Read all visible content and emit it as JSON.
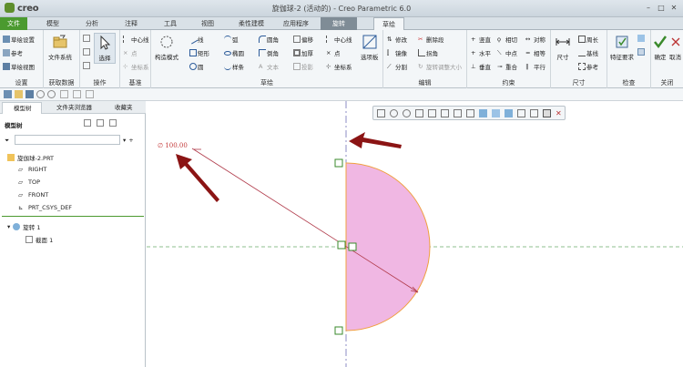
{
  "app": {
    "logo": "creo",
    "window_title": "旋伽球-2 (活动的) - Creo Parametric 6.0"
  },
  "colors": {
    "file_tab": "#4b9a2f",
    "context_tab": "#7f8c96",
    "arrow": "#8b1414",
    "fill": "#f0b7e3",
    "edge": "#f0a040",
    "dim": "#c43a3a"
  },
  "tabs": [
    {
      "label": "文件"
    },
    {
      "label": "模型"
    },
    {
      "label": "分析"
    },
    {
      "label": "注释"
    },
    {
      "label": "工具"
    },
    {
      "label": "视图"
    },
    {
      "label": "柔性建模"
    },
    {
      "label": "应用程序"
    },
    {
      "label": "旋转"
    },
    {
      "label": "草绘"
    }
  ],
  "ribbon": {
    "setup": {
      "label": "设置",
      "items": [
        "草绘设置",
        "参考",
        "草绘视图"
      ]
    },
    "get_data": {
      "label": "获取数据",
      "file_system": "文件系统"
    },
    "operations": {
      "label": "操作",
      "select": "选择"
    },
    "datum": {
      "label": "基准",
      "centerline": "中心线",
      "point": "点",
      "csys": "坐标系"
    },
    "sketch": {
      "label": "草绘",
      "construction": "构造模式",
      "line": "线",
      "arc": "弧",
      "rect": "矩形",
      "ellipse": "椭圆",
      "circle": "圆",
      "spline": "样条",
      "fillet": "圆角",
      "chamfer": "倒角",
      "text": "文本",
      "offset": "偏移",
      "thicken": "加厚",
      "project": "投影",
      "centerline": "中心线",
      "point": "点",
      "csys": "坐标系",
      "palette": "选项板"
    },
    "edit": {
      "label": "编辑",
      "modify": "修改",
      "delete_seg": "删除段",
      "mirror": "镜像",
      "corner": "拐角",
      "divide": "分割",
      "rotate_resize": "旋转调整大小"
    },
    "constrain": {
      "label": "约束",
      "vertical": "竖直",
      "tangent": "相切",
      "symmetric": "对称",
      "horizontal": "水平",
      "midpoint": "中点",
      "equal": "相等",
      "perpendicular": "垂直",
      "coincident": "重合",
      "parallel": "平行"
    },
    "dimension": {
      "label": "尺寸",
      "dim": "尺寸",
      "perimeter": "周长",
      "baseline": "基线",
      "reference": "参考"
    },
    "inspect": {
      "label": "检查",
      "feature_req": "特征要求"
    },
    "close": {
      "label": "关闭",
      "ok": "确定",
      "cancel": "取消"
    }
  },
  "panel": {
    "tabs": [
      "模型树",
      "文件夹浏览器",
      "收藏夹"
    ],
    "tree_title": "模型树",
    "items": [
      "旋伽球-2.PRT",
      "RIGHT",
      "TOP",
      "FRONT",
      "PRT_CSYS_DEF"
    ],
    "features": [
      "旋转 1",
      "截面 1"
    ]
  },
  "canvas": {
    "dimension": "∅ 100.00"
  }
}
